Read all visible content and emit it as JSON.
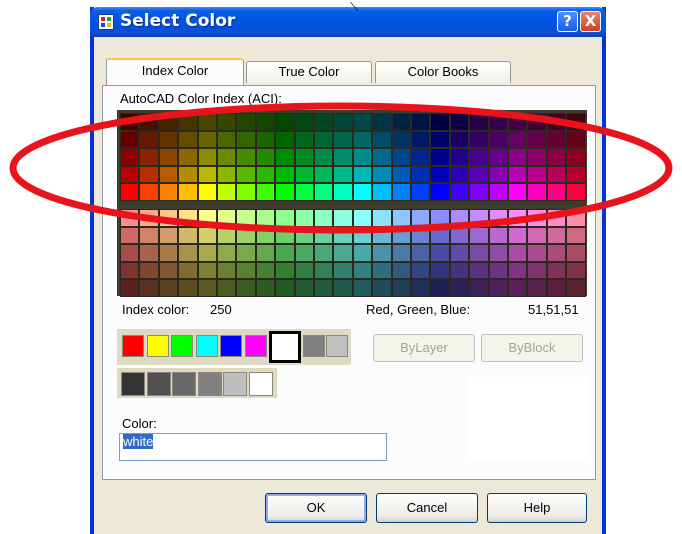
{
  "window": {
    "title": "Select Color",
    "help_button": "?",
    "close_button": "X"
  },
  "tabs": [
    {
      "label": "Index Color",
      "active": true
    },
    {
      "label": "True Color",
      "active": false
    },
    {
      "label": "Color Books",
      "active": false
    }
  ],
  "palette": {
    "label": "AutoCAD Color Index (ACI):",
    "hues": [
      "#ff0000",
      "#ff4000",
      "#ff7f00",
      "#ffbf00",
      "#ffff00",
      "#bfff00",
      "#7fff00",
      "#3fff00",
      "#00ff00",
      "#00ff3f",
      "#00ff7f",
      "#00ffbf",
      "#00ffff",
      "#00bfff",
      "#007fff",
      "#003fff",
      "#0000ff",
      "#3f00ff",
      "#7f00ff",
      "#bf00ff",
      "#ff00ff",
      "#ff00bf",
      "#ff007f",
      "#ff003f"
    ],
    "upper_rows_intensity": [
      0.28,
      0.4,
      0.55,
      0.72,
      1.0
    ],
    "lower_rows_pastel": [
      {
        "mix": 0.55,
        "dark": 1.0
      },
      {
        "mix": 0.5,
        "dark": 0.82
      },
      {
        "mix": 0.45,
        "dark": 0.66
      },
      {
        "mix": 0.4,
        "dark": 0.5
      },
      {
        "mix": 0.35,
        "dark": 0.36
      }
    ]
  },
  "info": {
    "index_label": "Index color:",
    "index_value": "250",
    "rgb_label": "Red, Green, Blue:",
    "rgb_value": "51,51,51"
  },
  "standard_colors": [
    "#ff0000",
    "#ffff00",
    "#00ff00",
    "#00ffff",
    "#0000ff",
    "#ff00ff",
    "#ffffff",
    "#808080",
    "#c0c0c0"
  ],
  "gray_shades": [
    "#333333",
    "#505050",
    "#696969",
    "#808080",
    "#bebebe",
    "#ffffff"
  ],
  "buttons": {
    "bylayer": "ByLayer",
    "byblock": "ByBlock",
    "ok": "OK",
    "cancel": "Cancel",
    "help": "Help"
  },
  "color_field": {
    "label": "Color:",
    "value": "white"
  },
  "annotation_color": "#e8141c"
}
